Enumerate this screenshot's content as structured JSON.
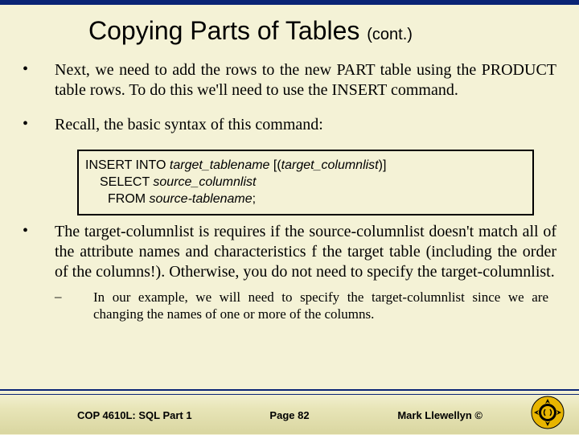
{
  "title": {
    "main": "Copying Parts of Tables",
    "cont": "(cont.)"
  },
  "bullets": [
    "Next, we need to add the rows to the new PART table using the PRODUCT table rows.  To do this we'll need to use the INSERT command.",
    "Recall, the basic syntax of this command:",
    "The target-columnlist is requires if the source-columnlist doesn't match all of the attribute names and characteristics f the target table (including the order of the columns!).  Otherwise, you do not need to specify the target-columnlist."
  ],
  "syntax": {
    "l1_kw": "INSERT INTO ",
    "l1_it1": "target_tablename",
    "l1_b1": " [(",
    "l1_it2": "target_columnlist",
    "l1_b2": ")]",
    "l2_kw": "SELECT ",
    "l2_it": "source_columnlist",
    "l3_kw": "FROM ",
    "l3_it": "source-tablename",
    "l3_end": ";"
  },
  "sub": "In our example, we will need to specify the target-columnlist since we are changing the names of one or more of the columns.",
  "footer": {
    "left": "COP 4610L: SQL Part 1",
    "center": "Page 82",
    "right": "Mark Llewellyn ©"
  }
}
